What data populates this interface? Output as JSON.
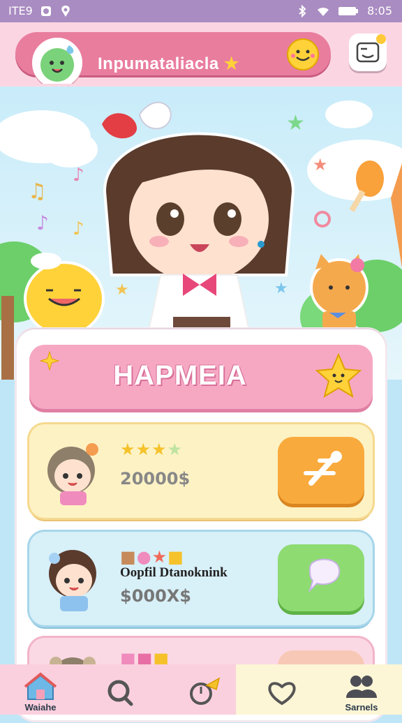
{
  "status_bar": {
    "left_text": "ITE9",
    "time": "8:05"
  },
  "header": {
    "title": "Inpumataliacla"
  },
  "banner": {
    "title": "HAPMEIA"
  },
  "rows": [
    {
      "stars": "★★★",
      "value": "20000$"
    },
    {
      "name": "Oopfil Dtanoknink",
      "value": "$000X$"
    },
    {
      "name": ""
    }
  ],
  "tabs": [
    {
      "icon": "house-icon",
      "label": "Waiahe"
    },
    {
      "icon": "search-icon",
      "label": ""
    },
    {
      "icon": "timer-icon",
      "label": ""
    },
    {
      "icon": "heart-icon",
      "label": ""
    },
    {
      "icon": "people-icon",
      "label": "Sarnels"
    }
  ],
  "colors": {
    "header_pill": "#e97d9e",
    "banner": "#f6a8c3",
    "accent_orange": "#f9aa3c",
    "accent_green": "#8edb72",
    "tabbar": "#fbd0de"
  }
}
